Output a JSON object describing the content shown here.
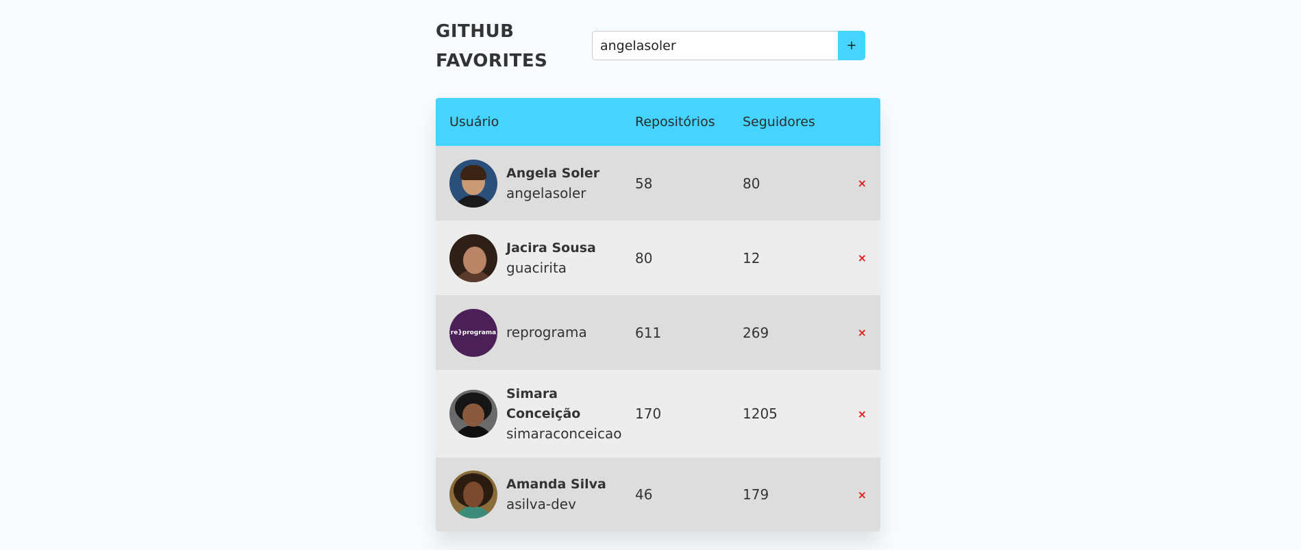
{
  "header": {
    "title": "GITHUB FAVORITES",
    "search_value": "angelasoler",
    "add_label": "+"
  },
  "table": {
    "columns": [
      "Usuário",
      "Repositórios",
      "Seguidores"
    ],
    "remove_label": "×",
    "rows": [
      {
        "name": "Angela Soler",
        "login": "angelasoler",
        "repos": "58",
        "followers": "80"
      },
      {
        "name": "Jacira Sousa",
        "login": "guacirita",
        "repos": "80",
        "followers": "12"
      },
      {
        "name": "",
        "login": "reprograma",
        "repos": "611",
        "followers": "269",
        "avatar_text": "{re}programa}"
      },
      {
        "name": "Simara Conceição",
        "login": "simaraconceicao",
        "repos": "170",
        "followers": "1205"
      },
      {
        "name": "Amanda Silva",
        "login": "asilva-dev",
        "repos": "46",
        "followers": "179"
      }
    ]
  },
  "colors": {
    "accent": "#44d4fe",
    "remove": "#e51c1c",
    "row_odd": "#dddddd",
    "row_even": "#eeeded",
    "background": "#f6fcff"
  }
}
